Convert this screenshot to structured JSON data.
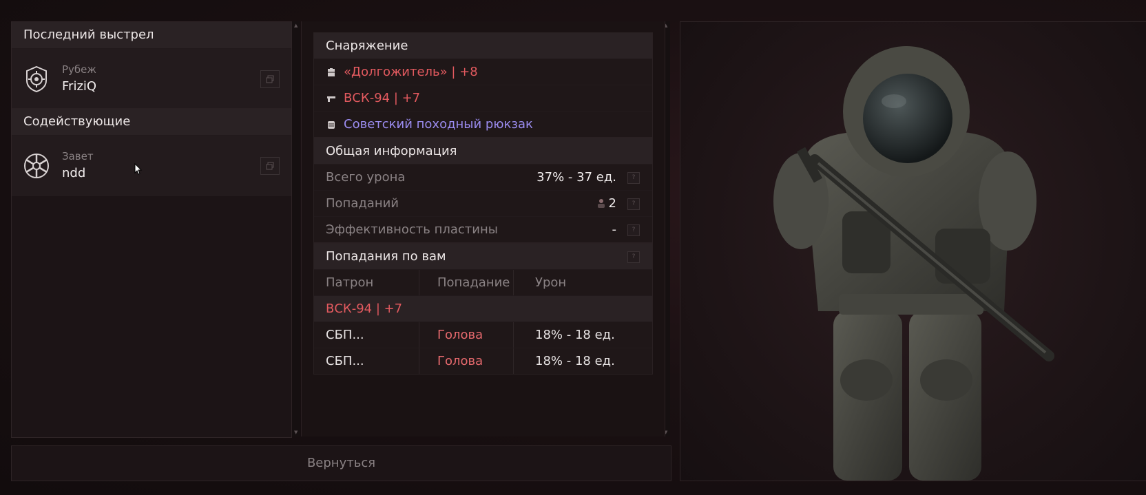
{
  "last_shot": {
    "title": "Последний выстрел",
    "player": {
      "group": "Рубеж",
      "name": "FriziQ"
    }
  },
  "assists": {
    "title": "Содействующие",
    "player": {
      "group": "Завет",
      "name": "ndd"
    }
  },
  "equipment": {
    "title": "Снаряжение",
    "items": [
      {
        "icon": "armor-icon",
        "label": "«Долгожитель» | +8",
        "color": "#e35a5f"
      },
      {
        "icon": "rifle-icon",
        "label": "ВСК-94 | +7",
        "color": "#e35a5f"
      },
      {
        "icon": "backpack-icon",
        "label": "Советский походный рюкзак",
        "color": "#9b8cf0"
      }
    ]
  },
  "general": {
    "title": "Общая информация",
    "rows": [
      {
        "label": "Всего урона",
        "value": "37% - 37 ед."
      },
      {
        "label": "Попаданий",
        "value": "2"
      },
      {
        "label": "Эффективность пластины",
        "value": "-"
      }
    ]
  },
  "hits": {
    "title": "Попадания по вам",
    "columns": [
      "Патрон",
      "Попадание",
      "Урон"
    ],
    "weapon": "ВСК-94 | +7",
    "rows": [
      {
        "ammo": "СБП...",
        "zone": "Голова",
        "damage": "18% - 18 ед."
      },
      {
        "ammo": "СБП...",
        "zone": "Голова",
        "damage": "18% - 18 ед."
      }
    ]
  },
  "back_button": "Вернуться",
  "help_glyph": "?",
  "colors": {
    "accent_red": "#e35a5f",
    "accent_purple": "#9b8cf0"
  }
}
